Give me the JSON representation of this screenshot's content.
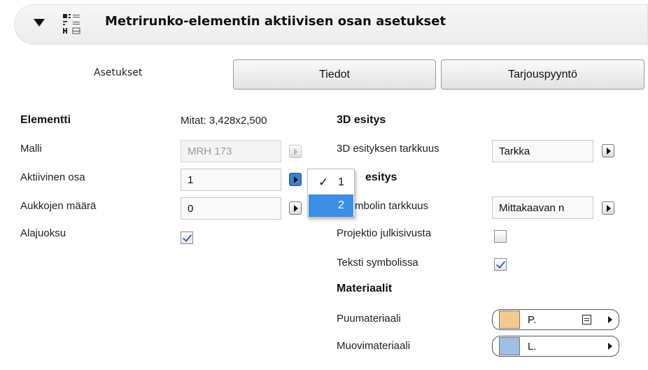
{
  "header": {
    "title": "Metrirunko-elementin aktiivisen osan asetukset"
  },
  "tabs": {
    "label": "Asetukset",
    "details": "Tiedot",
    "quote": "Tarjouspyyntö"
  },
  "element": {
    "heading": "Elementti",
    "size": "Mitat: 3,428x2,500",
    "model_label": "Malli",
    "model_value": "MRH 173",
    "active_part_label": "Aktiivinen osa",
    "active_part_value": "1",
    "openings_label": "Aukkojen määrä",
    "openings_value": "0",
    "bottom_label": "Alajuoksu",
    "bottom_checked": true
  },
  "dropdown": {
    "items": [
      "1",
      "2"
    ],
    "checked": "1",
    "highlighted": "2",
    "check_glyph": "✓"
  },
  "view3d": {
    "heading": "3D esitys",
    "detail_label": "3D esityksen tarkkuus",
    "detail_value": "Tarkka"
  },
  "view2d": {
    "heading_visible": "esitys",
    "symbol_label_visible": "mbolin tarkkuus",
    "symbol_value": "Mittakaavan n",
    "projection_label": "Projektio julkisivusta",
    "projection_checked": false,
    "text_label": "Teksti symbolissa",
    "text_checked": true
  },
  "materials": {
    "heading": "Materiaalit",
    "wood_label": "Puumateriaali",
    "wood_value": "P.",
    "wood_color": "#f5c98e",
    "plastic_label": "Muovimateriaali",
    "plastic_value": "L.",
    "plastic_color": "#9fc0e3"
  }
}
